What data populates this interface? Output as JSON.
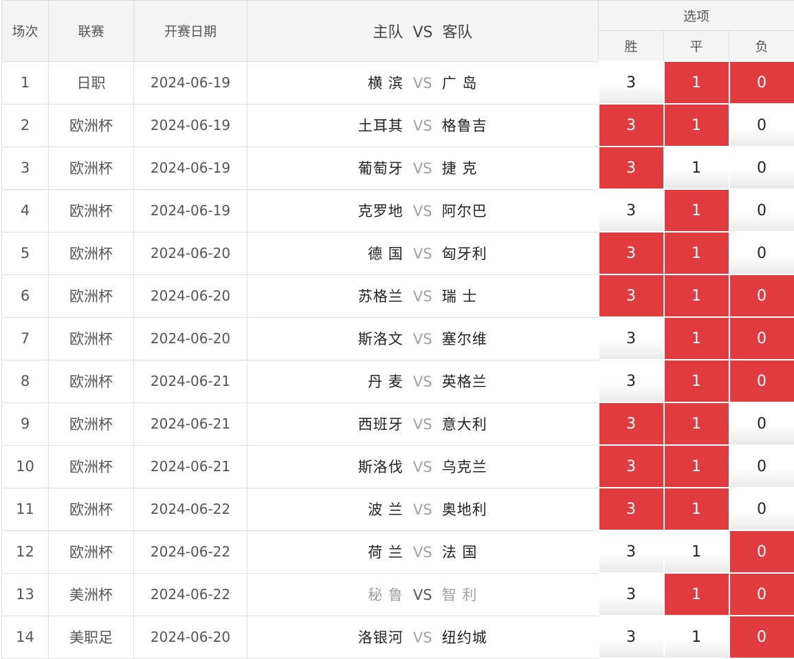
{
  "header": {
    "col_index": "场次",
    "col_league": "联赛",
    "col_date": "开赛日期",
    "col_home": "主队",
    "col_vs": "VS",
    "col_away": "客队",
    "col_options": "选项",
    "opt_win": "胜",
    "opt_draw": "平",
    "opt_lose": "负"
  },
  "colors": {
    "selected": "#e03c3f",
    "vs": "#a0a0a0"
  },
  "matches": [
    {
      "idx": "1",
      "league": "日职",
      "date": "2024-06-19",
      "home": "横 滨",
      "vs": "VS",
      "away": "广 岛",
      "win": "3",
      "draw": "1",
      "lose": "0",
      "win_sel": false,
      "draw_sel": true,
      "lose_sel": true,
      "muted": false
    },
    {
      "idx": "2",
      "league": "欧洲杯",
      "date": "2024-06-19",
      "home": "土耳其",
      "vs": "VS",
      "away": "格鲁吉",
      "win": "3",
      "draw": "1",
      "lose": "0",
      "win_sel": true,
      "draw_sel": true,
      "lose_sel": false,
      "muted": false
    },
    {
      "idx": "3",
      "league": "欧洲杯",
      "date": "2024-06-19",
      "home": "葡萄牙",
      "vs": "VS",
      "away": "捷 克",
      "win": "3",
      "draw": "1",
      "lose": "0",
      "win_sel": true,
      "draw_sel": false,
      "lose_sel": false,
      "muted": false
    },
    {
      "idx": "4",
      "league": "欧洲杯",
      "date": "2024-06-19",
      "home": "克罗地",
      "vs": "VS",
      "away": "阿尔巴",
      "win": "3",
      "draw": "1",
      "lose": "0",
      "win_sel": false,
      "draw_sel": true,
      "lose_sel": false,
      "muted": false
    },
    {
      "idx": "5",
      "league": "欧洲杯",
      "date": "2024-06-20",
      "home": "德 国",
      "vs": "VS",
      "away": "匈牙利",
      "win": "3",
      "draw": "1",
      "lose": "0",
      "win_sel": true,
      "draw_sel": true,
      "lose_sel": false,
      "muted": false
    },
    {
      "idx": "6",
      "league": "欧洲杯",
      "date": "2024-06-20",
      "home": "苏格兰",
      "vs": "VS",
      "away": "瑞 士",
      "win": "3",
      "draw": "1",
      "lose": "0",
      "win_sel": true,
      "draw_sel": true,
      "lose_sel": true,
      "muted": false
    },
    {
      "idx": "7",
      "league": "欧洲杯",
      "date": "2024-06-20",
      "home": "斯洛文",
      "vs": "VS",
      "away": "塞尔维",
      "win": "3",
      "draw": "1",
      "lose": "0",
      "win_sel": false,
      "draw_sel": true,
      "lose_sel": true,
      "muted": false
    },
    {
      "idx": "8",
      "league": "欧洲杯",
      "date": "2024-06-21",
      "home": "丹 麦",
      "vs": "VS",
      "away": "英格兰",
      "win": "3",
      "draw": "1",
      "lose": "0",
      "win_sel": false,
      "draw_sel": true,
      "lose_sel": true,
      "muted": false
    },
    {
      "idx": "9",
      "league": "欧洲杯",
      "date": "2024-06-21",
      "home": "西班牙",
      "vs": "VS",
      "away": "意大利",
      "win": "3",
      "draw": "1",
      "lose": "0",
      "win_sel": true,
      "draw_sel": true,
      "lose_sel": false,
      "muted": false
    },
    {
      "idx": "10",
      "league": "欧洲杯",
      "date": "2024-06-21",
      "home": "斯洛伐",
      "vs": "VS",
      "away": "乌克兰",
      "win": "3",
      "draw": "1",
      "lose": "0",
      "win_sel": true,
      "draw_sel": true,
      "lose_sel": false,
      "muted": false
    },
    {
      "idx": "11",
      "league": "欧洲杯",
      "date": "2024-06-22",
      "home": "波 兰",
      "vs": "VS",
      "away": "奥地利",
      "win": "3",
      "draw": "1",
      "lose": "0",
      "win_sel": true,
      "draw_sel": true,
      "lose_sel": false,
      "muted": false
    },
    {
      "idx": "12",
      "league": "欧洲杯",
      "date": "2024-06-22",
      "home": "荷 兰",
      "vs": "VS",
      "away": "法 国",
      "win": "3",
      "draw": "1",
      "lose": "0",
      "win_sel": false,
      "draw_sel": false,
      "lose_sel": true,
      "muted": false
    },
    {
      "idx": "13",
      "league": "美洲杯",
      "date": "2024-06-22",
      "home": "秘 鲁",
      "vs": "VS",
      "away": "智 利",
      "win": "3",
      "draw": "1",
      "lose": "0",
      "win_sel": false,
      "draw_sel": true,
      "lose_sel": true,
      "muted": true
    },
    {
      "idx": "14",
      "league": "美职足",
      "date": "2024-06-20",
      "home": "洛银河",
      "vs": "VS",
      "away": "纽约城",
      "win": "3",
      "draw": "1",
      "lose": "0",
      "win_sel": false,
      "draw_sel": false,
      "lose_sel": true,
      "muted": false
    }
  ]
}
